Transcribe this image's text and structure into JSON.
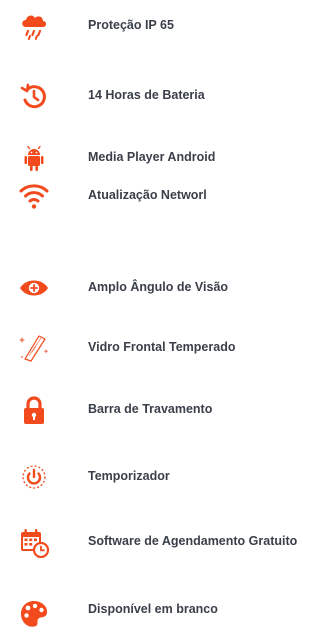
{
  "accent_color": "#f24a1d",
  "features": [
    {
      "icon": "rain-cloud-icon",
      "label": "Proteção IP 65"
    },
    {
      "icon": "history-clock-icon",
      "label": "14 Horas de Bateria"
    },
    {
      "icon": "android-icon",
      "label": "Media Player Android"
    },
    {
      "icon": "wifi-icon",
      "label": "Atualização Networl"
    },
    {
      "icon": "eye-plus-icon",
      "label": "Amplo Ângulo de Visão"
    },
    {
      "icon": "glass-panel-icon",
      "label": "Vidro Frontal Temperado"
    },
    {
      "icon": "padlock-icon",
      "label": "Barra de Travamento"
    },
    {
      "icon": "power-timer-icon",
      "label": "Temporizador"
    },
    {
      "icon": "calendar-clock-icon",
      "label": "Software de Agendamento Gratuito"
    },
    {
      "icon": "palette-icon",
      "label": "Disponível em branco"
    }
  ]
}
